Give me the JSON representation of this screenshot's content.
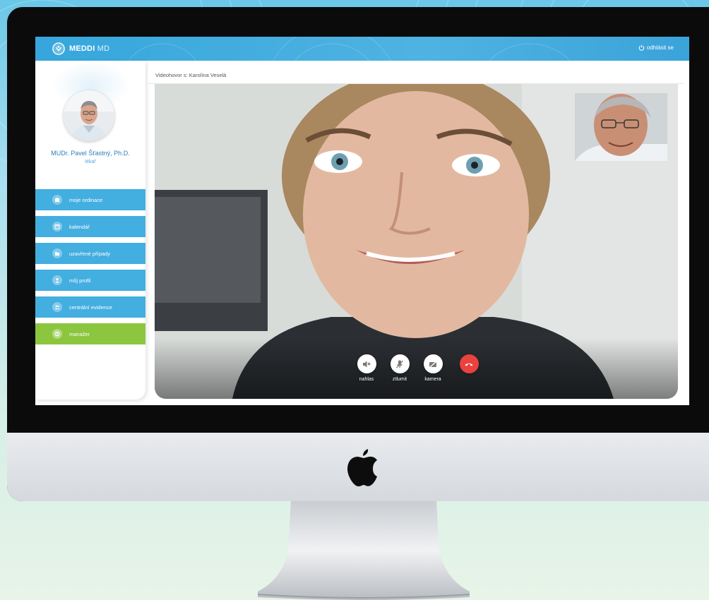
{
  "app": {
    "brand": "MEDDI",
    "brand_suffix": "MD",
    "logout_label": "odhlásit se"
  },
  "doctor": {
    "name": "MUDr. Pavel Šťastný, Ph.D.",
    "role": "lékař"
  },
  "sidebar": {
    "items": [
      {
        "label": "moje ordinace",
        "icon": "clinic-icon"
      },
      {
        "label": "kalendář",
        "icon": "calendar-icon"
      },
      {
        "label": "uzavřené případy",
        "icon": "folder-icon"
      },
      {
        "label": "můj profil",
        "icon": "user-icon"
      },
      {
        "label": "centrální evidence",
        "icon": "users-icon"
      },
      {
        "label": "manažer",
        "icon": "manager-icon"
      }
    ]
  },
  "call": {
    "title": "Videohovor s: Karolína Veselá",
    "controls": {
      "speaker": "nahlas",
      "mute": "ztlumit",
      "camera": "kamera"
    }
  },
  "colors": {
    "primary": "#43aee0",
    "manager_green": "#8cc63f",
    "hangup_red": "#e9423f"
  }
}
